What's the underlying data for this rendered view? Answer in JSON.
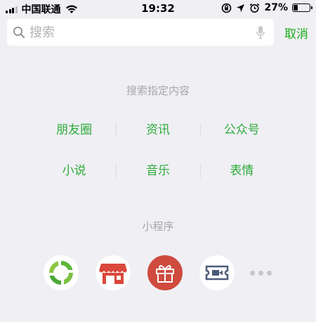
{
  "status_bar": {
    "carrier": "中国联通",
    "time": "19:32",
    "battery_percent": "27%",
    "battery_level": 0.27
  },
  "search": {
    "placeholder": "搜索",
    "value": "",
    "cancel_label": "取消"
  },
  "search_specified": {
    "title": "搜索指定内容",
    "rows": [
      [
        "朋友圈",
        "资讯",
        "公众号"
      ],
      [
        "小说",
        "音乐",
        "表情"
      ]
    ]
  },
  "mini_programs": {
    "title": "小程序",
    "apps": [
      {
        "icon": "recycle-icon",
        "color": "#5cb83a"
      },
      {
        "icon": "shop-icon",
        "color": "#d9483b"
      },
      {
        "icon": "gift-icon",
        "color": "#cf4b3e"
      },
      {
        "icon": "ticket-icon",
        "color": "#4a5b7a"
      }
    ],
    "more_icon": "more-dots-icon"
  },
  "colors": {
    "accent": "#1aad19",
    "category_text": "#2eab3a",
    "section_title": "#a8a8a8",
    "background": "#efeff4"
  }
}
